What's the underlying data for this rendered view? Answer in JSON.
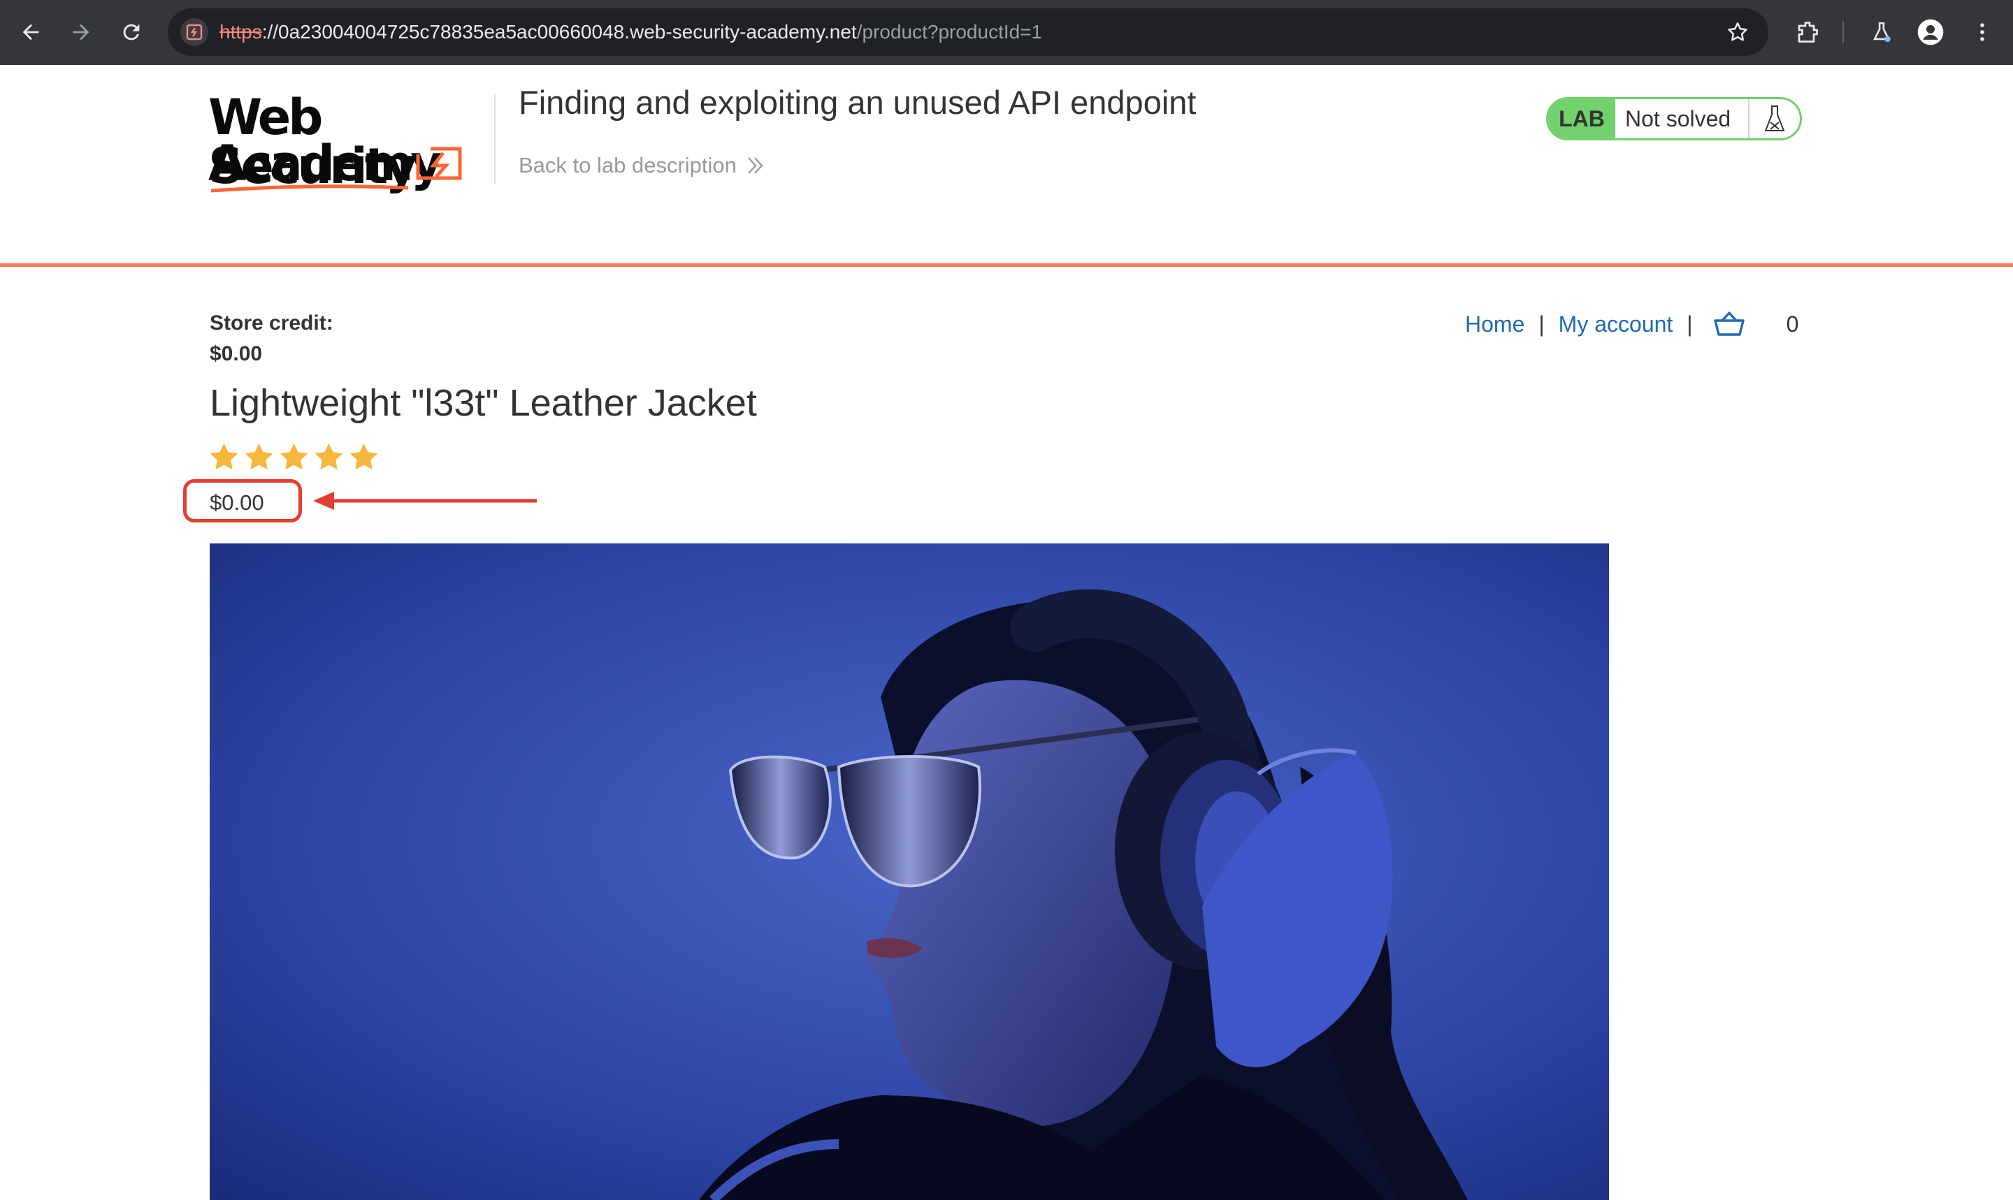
{
  "browser": {
    "url_scheme": "https",
    "url_host": "://0a23004004725c78835ea5ac00660048.web-security-academy.net",
    "url_path": "/product?productId=1",
    "icons": [
      "back-arrow-icon",
      "forward-arrow-icon",
      "reload-icon",
      "site-info-icon",
      "bookmark-star-icon",
      "extensions-icon",
      "labs-flask-icon",
      "profile-icon",
      "more-menu-icon"
    ]
  },
  "lab": {
    "logo_line1": "Web Security",
    "logo_line2": "Academy",
    "title": "Finding and exploiting an unused API endpoint",
    "back_link": "Back to lab description",
    "badge": "LAB",
    "status": "Not solved",
    "accent_color": "#ff6633",
    "status_color": "#70d16d"
  },
  "store": {
    "credit_label": "Store credit:",
    "credit_value": "$0.00",
    "nav": {
      "home": "Home",
      "separator": "|",
      "account": "My account",
      "cart_count": "0"
    },
    "product": {
      "title": "Lightweight \"l33t\" Leather Jacket",
      "rating_stars": 5,
      "price": "$0.00",
      "image_alt": "Woman wearing sunglasses and headphones under blue light"
    }
  },
  "annotation": {
    "highlight_color": "#e53d2f",
    "target": "price"
  }
}
